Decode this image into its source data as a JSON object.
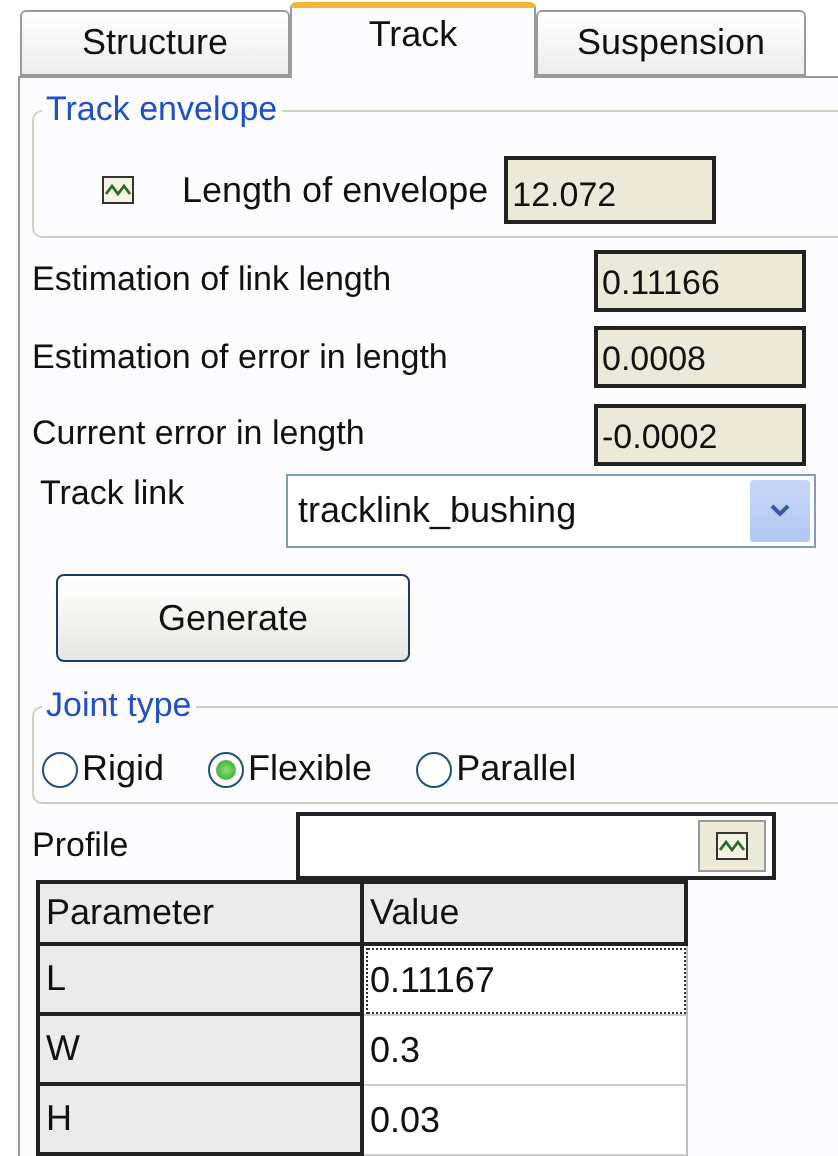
{
  "tabs": [
    {
      "label": "Structure",
      "selected": false
    },
    {
      "label": "Track",
      "selected": true
    },
    {
      "label": "Suspension",
      "selected": false
    }
  ],
  "envelope_group": {
    "title": "Track envelope",
    "label": "Length of envelope",
    "value": "12.072"
  },
  "fields": [
    {
      "label": "Estimation of link length",
      "value": "0.11166"
    },
    {
      "label": "Estimation of error in length",
      "value": "0.0008"
    },
    {
      "label": "Current error in length",
      "value": "-0.0002"
    }
  ],
  "track_link": {
    "label": "Track link",
    "value": "tracklink_bushing"
  },
  "generate_button": "Generate",
  "joint_type": {
    "title": "Joint type",
    "options": [
      {
        "label": "Rigid",
        "selected": false
      },
      {
        "label": "Flexible",
        "selected": true
      },
      {
        "label": "Parallel",
        "selected": false
      }
    ]
  },
  "profile": {
    "label": "Profile"
  },
  "table": {
    "columns": [
      "Parameter",
      "Value"
    ],
    "rows": [
      {
        "parameter": "L",
        "value": "0.11167",
        "selected": true
      },
      {
        "parameter": "W",
        "value": "0.3",
        "selected": false
      },
      {
        "parameter": "H",
        "value": "0.03",
        "selected": false
      }
    ]
  }
}
